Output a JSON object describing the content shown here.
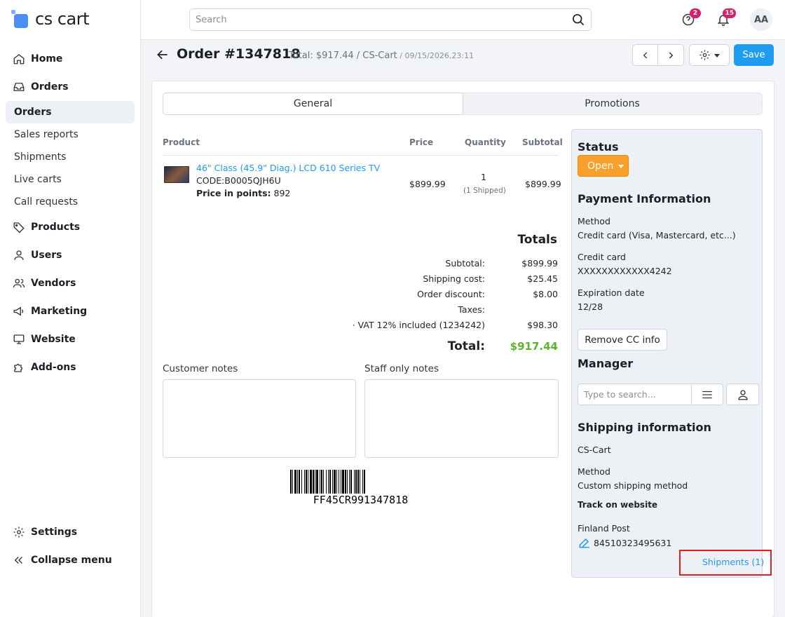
{
  "app": {
    "logo_text": "cs cart"
  },
  "sidebar": {
    "home": "Home",
    "orders": "Orders",
    "orders_sub": [
      "Orders",
      "Sales reports",
      "Shipments",
      "Live carts",
      "Call requests"
    ],
    "products": "Products",
    "users": "Users",
    "vendors": "Vendors",
    "marketing": "Marketing",
    "website": "Website",
    "addons": "Add-ons",
    "settings": "Settings",
    "collapse": "Collapse menu"
  },
  "topbar": {
    "search_placeholder": "Search",
    "help_badge": "2",
    "notifications_badge": "15",
    "avatar_initials": "AA"
  },
  "header": {
    "title": "Order #1347818",
    "subtitle": "Total: $917.44 / CS-Cart",
    "date": " / 09/15/2026,23:11",
    "save_label": "Save"
  },
  "tabs": [
    "General",
    "Promotions"
  ],
  "products_table": {
    "headers": {
      "product": "Product",
      "price": "Price",
      "quantity": "Quantity",
      "subtotal": "Subtotal"
    },
    "rows": [
      {
        "name": "46\" Class (45.9\" Diag.) LCD 610 Series TV",
        "code": "CODE:B0005QJH6U",
        "points_label": "Price in points:",
        "points_value": " 892",
        "price": "$899.99",
        "quantity": "1",
        "shipped": "(1 Shipped)",
        "subtotal": "$899.99"
      }
    ]
  },
  "totals": {
    "title": "Totals",
    "subtotal_label": "Subtotal:",
    "subtotal_value": "$899.99",
    "shipping_label": "Shipping cost:",
    "shipping_value": "$25.45",
    "discount_label": "Order discount:",
    "discount_value": "$8.00",
    "taxes_label": "Taxes:",
    "vat_label": "· VAT 12% included (1234242)",
    "vat_value": "$98.30",
    "total_label": "Total:",
    "total_value": "$917.44"
  },
  "notes": {
    "customer_label": "Customer notes",
    "staff_label": "Staff only notes"
  },
  "barcode": {
    "text": "FF45CR991347818"
  },
  "panel": {
    "status_title": "Status",
    "status_value": "Open",
    "payment_title": "Payment Information",
    "method_label": "Method",
    "method_value": "Credit card (Visa, Mastercard, etc...)",
    "cc_label": "Credit card",
    "cc_value": "XXXXXXXXXXXX4242",
    "exp_label": "Expiration date",
    "exp_value": "12/28",
    "remove_cc": "Remove CC info",
    "manager_title": "Manager",
    "manager_placeholder": "Type to search...",
    "shipping_title": "Shipping information",
    "shipping_vendor": "CS-Cart",
    "shipping_method_label": "Method",
    "shipping_method_value": "Custom shipping method",
    "track_label": "Track on website",
    "carrier": "Finland Post",
    "tracking_number": "84510323495631",
    "shipments_link": "Shipments (1)"
  },
  "colors": {
    "accent": "#1e9cf0",
    "status_open": "#f9a02a",
    "total_green": "#5bb52a",
    "badge": "#d6206a",
    "highlight": "#e02020"
  }
}
